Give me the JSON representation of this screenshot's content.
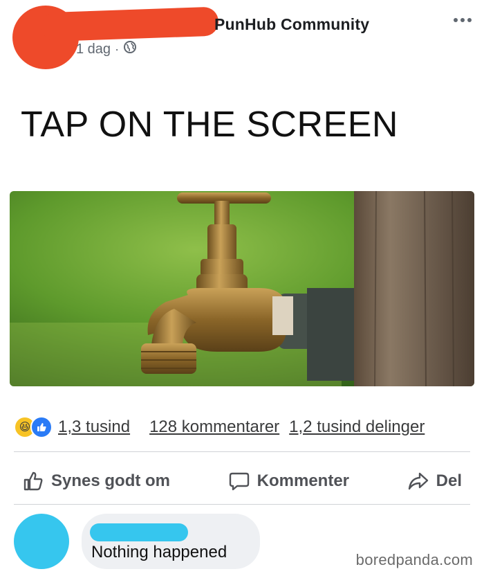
{
  "post": {
    "group_name": "PunHub Community",
    "time": "1 dag",
    "separator": "·",
    "visibility_icon": "globe-icon",
    "text": "TAP ON THE SCREEN",
    "image_subject": "faucet-photo"
  },
  "stats": {
    "reaction_icons": [
      "haha-reaction-icon",
      "like-reaction-icon"
    ],
    "reactions": "1,3 tusind",
    "comments": "128 kommentarer",
    "shares": "1,2 tusind delinger"
  },
  "actions": {
    "like": "Synes godt om",
    "comment": "Kommenter",
    "share": "Del"
  },
  "comment": {
    "text": "Nothing happened"
  },
  "watermark": "boredpanda.com",
  "colors": {
    "redaction_header": "#ee4a2a",
    "redaction_comment": "#36c6ee",
    "like_blue": "#2a7bf6",
    "haha_yellow": "#f7c325"
  }
}
